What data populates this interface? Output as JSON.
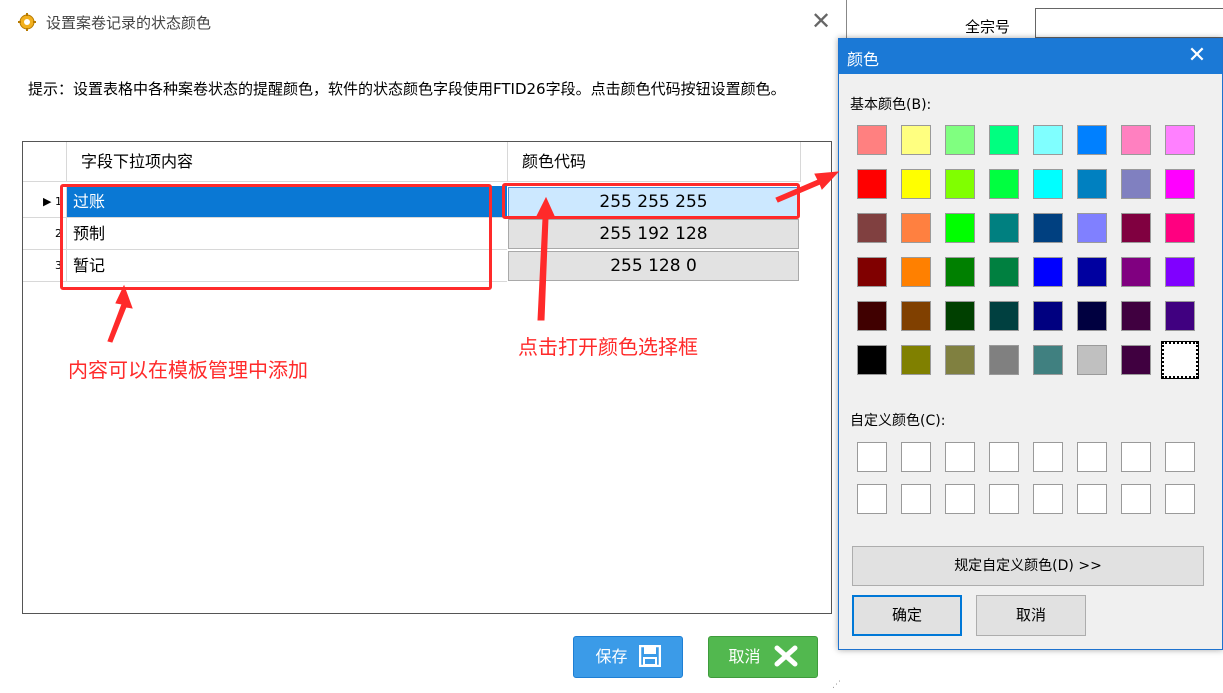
{
  "main_dialog": {
    "title": "设置案卷记录的状态颜色",
    "hint": "提示：设置表格中各种案卷状态的提醒颜色，软件的状态颜色字段使用FTID26字段。点击颜色代码按钮设置颜色。",
    "columns": [
      "字段下拉项内容",
      "颜色代码"
    ],
    "rows": [
      {
        "index": "1",
        "name": "过账",
        "color_code": "255 255 255",
        "selected": true
      },
      {
        "index": "2",
        "name": "预制",
        "color_code": "255 192 128",
        "selected": false
      },
      {
        "index": "3",
        "name": "暂记",
        "color_code": "255 128 0",
        "selected": false
      }
    ],
    "save_label": "保存",
    "cancel_label": "取消"
  },
  "background_form": {
    "label": "全宗号"
  },
  "color_dialog": {
    "title": "颜色",
    "basic_colors_label": "基本颜色(B):",
    "custom_colors_label": "自定义颜色(C):",
    "define_custom_label": "规定自定义颜色(D) >>",
    "ok_label": "确定",
    "cancel_label": "取消",
    "basic_colors": [
      "#ff8080",
      "#ffff80",
      "#80ff80",
      "#00ff80",
      "#80ffff",
      "#0080ff",
      "#ff80c0",
      "#ff80ff",
      "#ff0000",
      "#ffff00",
      "#80ff00",
      "#00ff40",
      "#00ffff",
      "#0080c0",
      "#8080c0",
      "#ff00ff",
      "#804040",
      "#ff8040",
      "#00ff00",
      "#008080",
      "#004080",
      "#8080ff",
      "#800040",
      "#ff0080",
      "#800000",
      "#ff8000",
      "#008000",
      "#008040",
      "#0000ff",
      "#0000a0",
      "#800080",
      "#8000ff",
      "#400000",
      "#804000",
      "#004000",
      "#004040",
      "#000080",
      "#000040",
      "#400040",
      "#400080",
      "#000000",
      "#808000",
      "#808040",
      "#808080",
      "#408080",
      "#c0c0c0",
      "#400040",
      "#ffffff"
    ]
  },
  "annotations": {
    "content_note": "内容可以在模板管理中添加",
    "click_note": "点击打开颜色选择框"
  }
}
